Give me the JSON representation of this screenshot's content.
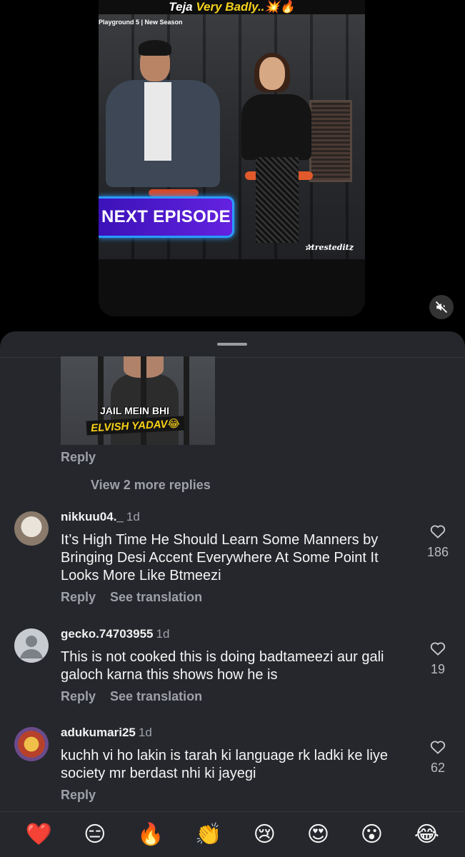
{
  "video": {
    "caption_white": "Teja ",
    "caption_yellow": "Very Badly..",
    "caption_emoji": "💥🔥",
    "frame_label": "Playground 5 | New Season",
    "banner_text": "NEXT EPISODE",
    "watermark": "✰tresteditz"
  },
  "gif": {
    "line1": "JAIL MEIN BHI",
    "line2": "ELVISH YADAV😂"
  },
  "thread": {
    "reply_label": "Reply",
    "view_more": "View 2 more replies"
  },
  "comments": [
    {
      "username": "nikkuu04._",
      "time": "1d",
      "text": "It’s High Time He Should Learn Some Manners by Bringing Desi Accent Everywhere At Some Point It Looks More Like Btmeezi",
      "reply_label": "Reply",
      "translate_label": "See translation",
      "likes": "186"
    },
    {
      "username": "gecko.74703955",
      "time": "1d",
      "text": "This is not cooked this is doing badtameezi aur gali galoch karna this shows how he is",
      "reply_label": "Reply",
      "translate_label": "See translation",
      "likes": "19"
    },
    {
      "username": "adukumari25",
      "time": "1d",
      "text": "kuchh vi ho lakin is tarah ki language rk ladki ke liye society mr berdast nhi ki jayegi",
      "reply_label": "Reply",
      "likes": "62"
    }
  ],
  "emoji_bar": [
    "❤️",
    "😑",
    "🔥",
    "👏",
    "😢",
    "😍",
    "😮",
    "😂"
  ],
  "icons": {
    "heart": "heart-outline-icon",
    "mute": "speaker-muted-icon"
  },
  "colors": {
    "sheet_bg": "#25272c",
    "muted_text": "#9ea1a7",
    "banner_accent": "#2a9bff",
    "caption_yellow": "#f4d21d"
  }
}
